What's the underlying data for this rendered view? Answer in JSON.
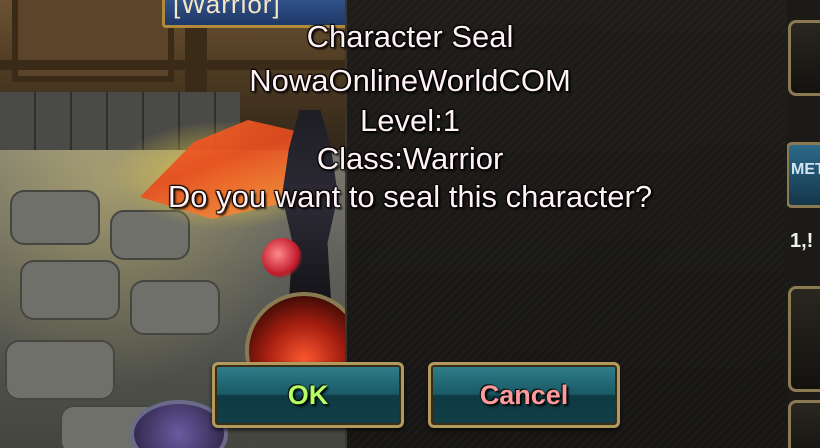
{
  "background": {
    "character_name_plate": "[Warrior]"
  },
  "side_hud": {
    "tab_label": "MET",
    "value_text": "1,!"
  },
  "dialog": {
    "title": "Character Seal",
    "character_name": "NowaOnlineWorldCOM",
    "level_text": "Level:1",
    "class_text": "Class:Warrior",
    "question": "Do you want to seal this character?",
    "ok_label": "OK",
    "cancel_label": "Cancel"
  },
  "colors": {
    "ok_text": "#b6ff63",
    "cancel_text": "#ff9a9a",
    "button_teal": "#1a5a66",
    "button_border": "#b29a5e",
    "dialog_text": "#fff1f4"
  },
  "icons": [
    "skill-fire-icon",
    "character-sprite"
  ]
}
